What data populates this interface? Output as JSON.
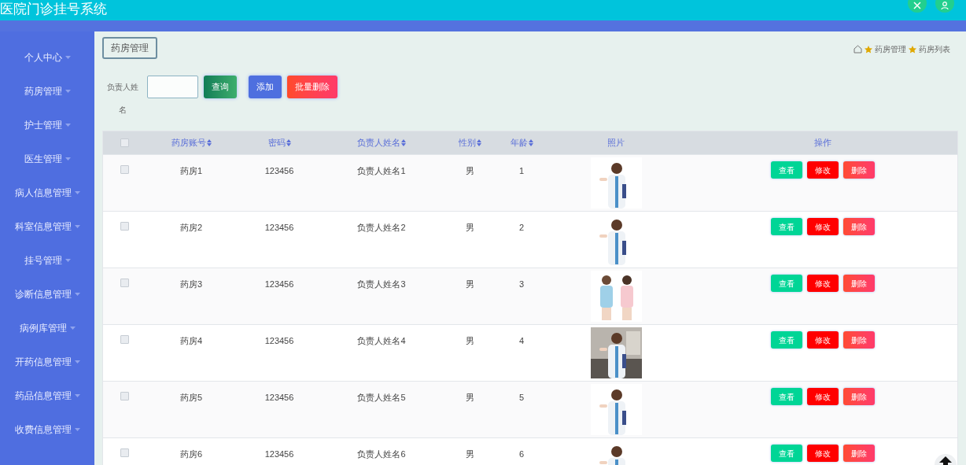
{
  "header": {
    "title": "医院门诊挂号系统"
  },
  "sidebar": {
    "items": [
      {
        "label": "个人中心"
      },
      {
        "label": "药房管理"
      },
      {
        "label": "护士管理"
      },
      {
        "label": "医生管理"
      },
      {
        "label": "病人信息管理"
      },
      {
        "label": "科室信息管理"
      },
      {
        "label": "挂号管理"
      },
      {
        "label": "诊断信息管理"
      },
      {
        "label": "病例库管理"
      },
      {
        "label": "开药信息管理"
      },
      {
        "label": "药品信息管理"
      },
      {
        "label": "收费信息管理"
      }
    ]
  },
  "page_tab": "药房管理",
  "breadcrumb": [
    "药房管理",
    "药房列表"
  ],
  "search": {
    "label": "负责人姓名",
    "buttons": [
      {
        "label": "查询",
        "kind": "search"
      },
      {
        "label": "添加",
        "kind": "add"
      },
      {
        "label": "批量删除",
        "kind": "delete"
      }
    ]
  },
  "table": {
    "select_all": {
      "checked": false
    },
    "columns": [
      {
        "label": "药房账号",
        "sortable": true
      },
      {
        "label": "密码",
        "sortable": true
      },
      {
        "label": "负责人姓名",
        "sortable": true
      },
      {
        "label": "性别",
        "sortable": true
      },
      {
        "label": "年龄",
        "sortable": true
      },
      {
        "label": "照片",
        "sortable": false
      },
      {
        "label": "操作",
        "sortable": false
      }
    ],
    "rows": [
      {
        "checked": false,
        "cells": [
          "药房1",
          "123456",
          "负责人姓名1",
          "男",
          "1"
        ],
        "actions": [
          {
            "label": "查看",
            "kind": "view"
          },
          {
            "label": "修改",
            "kind": "edit"
          },
          {
            "label": "删除",
            "kind": "delete"
          }
        ]
      },
      {
        "checked": false,
        "cells": [
          "药房2",
          "123456",
          "负责人姓名2",
          "男",
          "2"
        ],
        "actions": [
          {
            "label": "查看",
            "kind": "view"
          },
          {
            "label": "修改",
            "kind": "edit"
          },
          {
            "label": "删除",
            "kind": "delete"
          }
        ]
      },
      {
        "checked": false,
        "cells": [
          "药房3",
          "123456",
          "负责人姓名3",
          "男",
          "3"
        ],
        "actions": [
          {
            "label": "查看",
            "kind": "view"
          },
          {
            "label": "修改",
            "kind": "edit"
          },
          {
            "label": "删除",
            "kind": "delete"
          }
        ]
      },
      {
        "checked": false,
        "cells": [
          "药房4",
          "123456",
          "负责人姓名4",
          "男",
          "4"
        ],
        "actions": [
          {
            "label": "查看",
            "kind": "view"
          },
          {
            "label": "修改",
            "kind": "edit"
          },
          {
            "label": "删除",
            "kind": "delete"
          }
        ]
      },
      {
        "checked": false,
        "cells": [
          "药房5",
          "123456",
          "负责人姓名5",
          "男",
          "5"
        ],
        "actions": [
          {
            "label": "查看",
            "kind": "view"
          },
          {
            "label": "修改",
            "kind": "edit"
          },
          {
            "label": "删除",
            "kind": "delete"
          }
        ]
      },
      {
        "checked": false,
        "cells": [
          "药房6",
          "123456",
          "负责人姓名6",
          "男",
          "6"
        ],
        "actions": [
          {
            "label": "查看",
            "kind": "view"
          },
          {
            "label": "修改",
            "kind": "edit"
          },
          {
            "label": "删除",
            "kind": "delete"
          }
        ]
      }
    ]
  }
}
